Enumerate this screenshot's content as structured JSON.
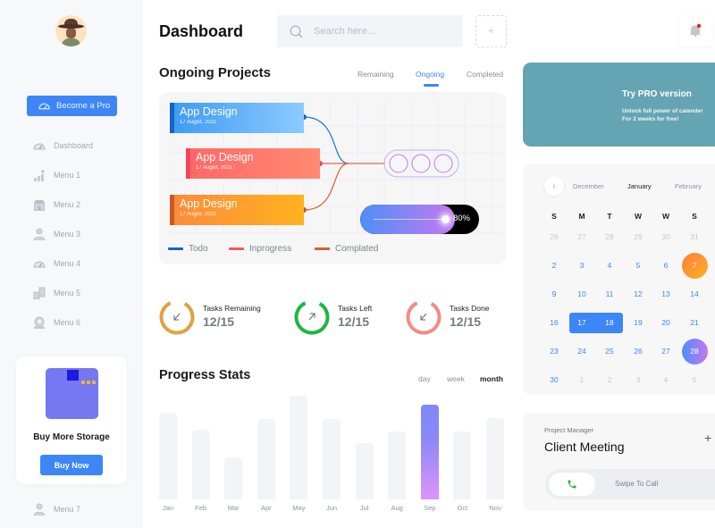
{
  "sidebar": {
    "avatar_alt": "user-avatar",
    "become_pro_label": "Become a Pro",
    "items": [
      {
        "label": "Dashboard",
        "icon": "speedometer-icon"
      },
      {
        "label": "Menu 1",
        "icon": "growth-chart-icon"
      },
      {
        "label": "Menu 2",
        "icon": "store-icon"
      },
      {
        "label": "Menu 3",
        "icon": "user-icon"
      },
      {
        "label": "Menu 4",
        "icon": "speedometer-icon"
      },
      {
        "label": "Menu 5",
        "icon": "buildings-icon"
      },
      {
        "label": "Menu 6",
        "icon": "settings-hand-icon"
      }
    ],
    "storage": {
      "title": "Buy More Storage",
      "button_label": "Buy Now"
    },
    "bottom_item": {
      "label": "Menu 7",
      "icon": "user-icon"
    }
  },
  "header": {
    "title": "Dashboard",
    "search_placeholder": "Search here...",
    "add_label": "+"
  },
  "ongoing": {
    "title": "Ongoing Projects",
    "tabs": [
      {
        "label": "Remaining",
        "active": false
      },
      {
        "label": "Ongoing",
        "active": true
      },
      {
        "label": "Completed",
        "active": false
      }
    ],
    "projects": [
      {
        "title": "App Design",
        "date": "17 Augist, 2021",
        "status": "Todo"
      },
      {
        "title": "App Design",
        "date": "17 Augist, 2021",
        "status": "Inprogress"
      },
      {
        "title": "App Design",
        "date": "17 Augist, 2021",
        "status": "Complated"
      }
    ],
    "legend": [
      {
        "label": "Todo",
        "color": "#1565c0"
      },
      {
        "label": "Inprogress",
        "color": "#f25a5a"
      },
      {
        "label": "Complated",
        "color": "#d9602a"
      }
    ],
    "progress_percent": 80,
    "progress_label": "80%"
  },
  "tasks": [
    {
      "label": "Tasks Remaining",
      "value": "12/15",
      "color": "#e2a040",
      "arrow": "arrow-down-left-icon"
    },
    {
      "label": "Tasks Left",
      "value": "12/15",
      "color": "#1db83d",
      "arrow": "arrow-up-right-icon"
    },
    {
      "label": "Tasks Done",
      "value": "12/15",
      "color": "#f58a86",
      "arrow": "arrow-down-left-icon"
    }
  ],
  "progress_stats": {
    "title": "Progress Stats",
    "tabs": [
      {
        "label": "day",
        "active": false
      },
      {
        "label": "week",
        "active": false
      },
      {
        "label": "month",
        "active": true
      }
    ]
  },
  "chart_data": {
    "type": "bar",
    "title": "Progress Stats",
    "categories": [
      "Jan",
      "Feb",
      "Mar",
      "Apr",
      "May",
      "Jun",
      "Jul",
      "Aug",
      "Sep",
      "Oct",
      "Nov"
    ],
    "values": [
      96,
      78,
      47,
      90,
      116,
      90,
      63,
      76,
      106,
      76,
      91
    ],
    "highlighted": "Sep",
    "ylim": [
      0,
      120
    ],
    "grid": false,
    "xlabel": "",
    "ylabel": ""
  },
  "promo": {
    "title": "Try PRO version",
    "line1": "Unlock full power of calender",
    "line2": "For 2 weeks for free!"
  },
  "calendar": {
    "prev_month": "December",
    "current_month": "January",
    "next_month": "February",
    "weekdays": [
      "S",
      "M",
      "T",
      "W",
      "W",
      "S"
    ],
    "weeks": [
      [
        {
          "d": "26",
          "muted": true
        },
        {
          "d": "27",
          "muted": true
        },
        {
          "d": "28",
          "muted": true
        },
        {
          "d": "29",
          "muted": true
        },
        {
          "d": "30",
          "muted": true
        },
        {
          "d": "31",
          "muted": true
        }
      ],
      [
        {
          "d": "2"
        },
        {
          "d": "3"
        },
        {
          "d": "4"
        },
        {
          "d": "5"
        },
        {
          "d": "6"
        },
        {
          "d": "7",
          "mark": "orange"
        }
      ],
      [
        {
          "d": "9"
        },
        {
          "d": "10"
        },
        {
          "d": "11"
        },
        {
          "d": "12"
        },
        {
          "d": "13"
        },
        {
          "d": "14"
        }
      ],
      [
        {
          "d": "16"
        },
        {
          "d": "17",
          "mark": "range"
        },
        {
          "d": "18",
          "mark": "range"
        },
        {
          "d": "19"
        },
        {
          "d": "20"
        },
        {
          "d": "21"
        }
      ],
      [
        {
          "d": "23"
        },
        {
          "d": "24"
        },
        {
          "d": "25"
        },
        {
          "d": "26"
        },
        {
          "d": "27"
        },
        {
          "d": "28",
          "mark": "purple"
        }
      ],
      [
        {
          "d": "30"
        },
        {
          "d": "1",
          "muted": true
        },
        {
          "d": "2",
          "muted": true
        },
        {
          "d": "3",
          "muted": true
        },
        {
          "d": "4",
          "muted": true
        },
        {
          "d": "5",
          "muted": true
        }
      ]
    ]
  },
  "meeting": {
    "role": "Project Manager",
    "title": "Client Meeting",
    "add_label": "+",
    "swipe_label": "Swipe To Call"
  },
  "colors": {
    "accent": "#3d86f7",
    "promo_bg": "#65a4b2",
    "notification_dot": "#ff1a1a"
  }
}
